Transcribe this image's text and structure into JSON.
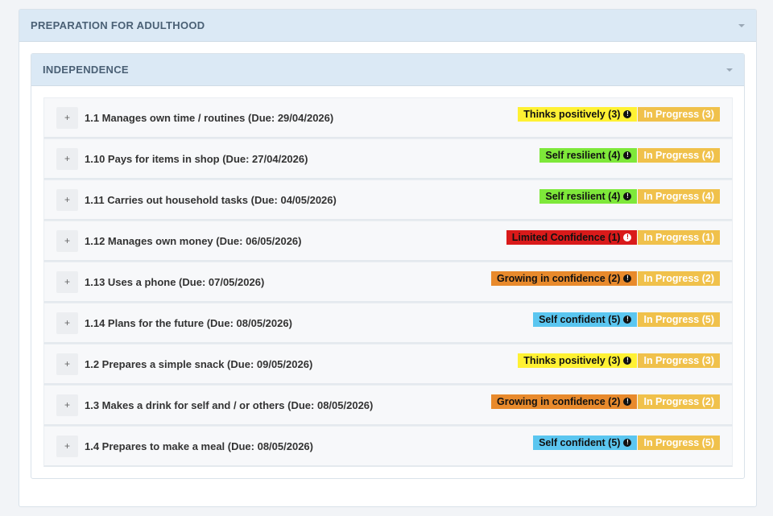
{
  "outer": {
    "title": "PREPARATION FOR ADULTHOOD"
  },
  "inner": {
    "title": "INDEPENDENCE"
  },
  "colors": {
    "thinks_positively": "#fff133",
    "self_resilient": "#7ee83a",
    "limited_confidence": "#d91a1a",
    "growing_confidence": "#e88a2c",
    "self_confident": "#5bc6f0",
    "in_progress": "#f0c14b"
  },
  "items": [
    {
      "plus": "+",
      "title": "1.1 Manages own time / routines (Due: 29/04/2026)",
      "level": "Thinks positively (3)",
      "level_color": "#fff133",
      "level_text_color": "#111111",
      "status": "In Progress (3)"
    },
    {
      "plus": "+",
      "title": "1.10 Pays for items in shop (Due: 27/04/2026)",
      "level": "Self resilient (4)",
      "level_color": "#7ee83a",
      "level_text_color": "#111111",
      "status": "In Progress (4)"
    },
    {
      "plus": "+",
      "title": "1.11 Carries out household tasks (Due: 04/05/2026)",
      "level": "Self resilient (4)",
      "level_color": "#7ee83a",
      "level_text_color": "#111111",
      "status": "In Progress (4)"
    },
    {
      "plus": "+",
      "title": "1.12 Manages own money (Due: 06/05/2026)",
      "level": "Limited Confidence (1)",
      "level_color": "#d91a1a",
      "level_text_color": "#111111",
      "status": "In Progress (1)"
    },
    {
      "plus": "+",
      "title": "1.13 Uses a phone (Due: 07/05/2026)",
      "level": "Growing in confidence (2)",
      "level_color": "#e88a2c",
      "level_text_color": "#111111",
      "status": "In Progress (2)"
    },
    {
      "plus": "+",
      "title": "1.14 Plans for the future (Due: 08/05/2026)",
      "level": "Self confident (5)",
      "level_color": "#5bc6f0",
      "level_text_color": "#111111",
      "status": "In Progress (5)"
    },
    {
      "plus": "+",
      "title": "1.2 Prepares a simple snack (Due: 09/05/2026)",
      "level": "Thinks positively (3)",
      "level_color": "#fff133",
      "level_text_color": "#111111",
      "status": "In Progress (3)"
    },
    {
      "plus": "+",
      "title": "1.3 Makes a drink for self and / or others (Due: 08/05/2026)",
      "level": "Growing in confidence (2)",
      "level_color": "#e88a2c",
      "level_text_color": "#111111",
      "status": "In Progress (2)"
    },
    {
      "plus": "+",
      "title": "1.4 Prepares to make a meal (Due: 08/05/2026)",
      "level": "Self confident (5)",
      "level_color": "#5bc6f0",
      "level_text_color": "#111111",
      "status": "In Progress (5)"
    }
  ]
}
